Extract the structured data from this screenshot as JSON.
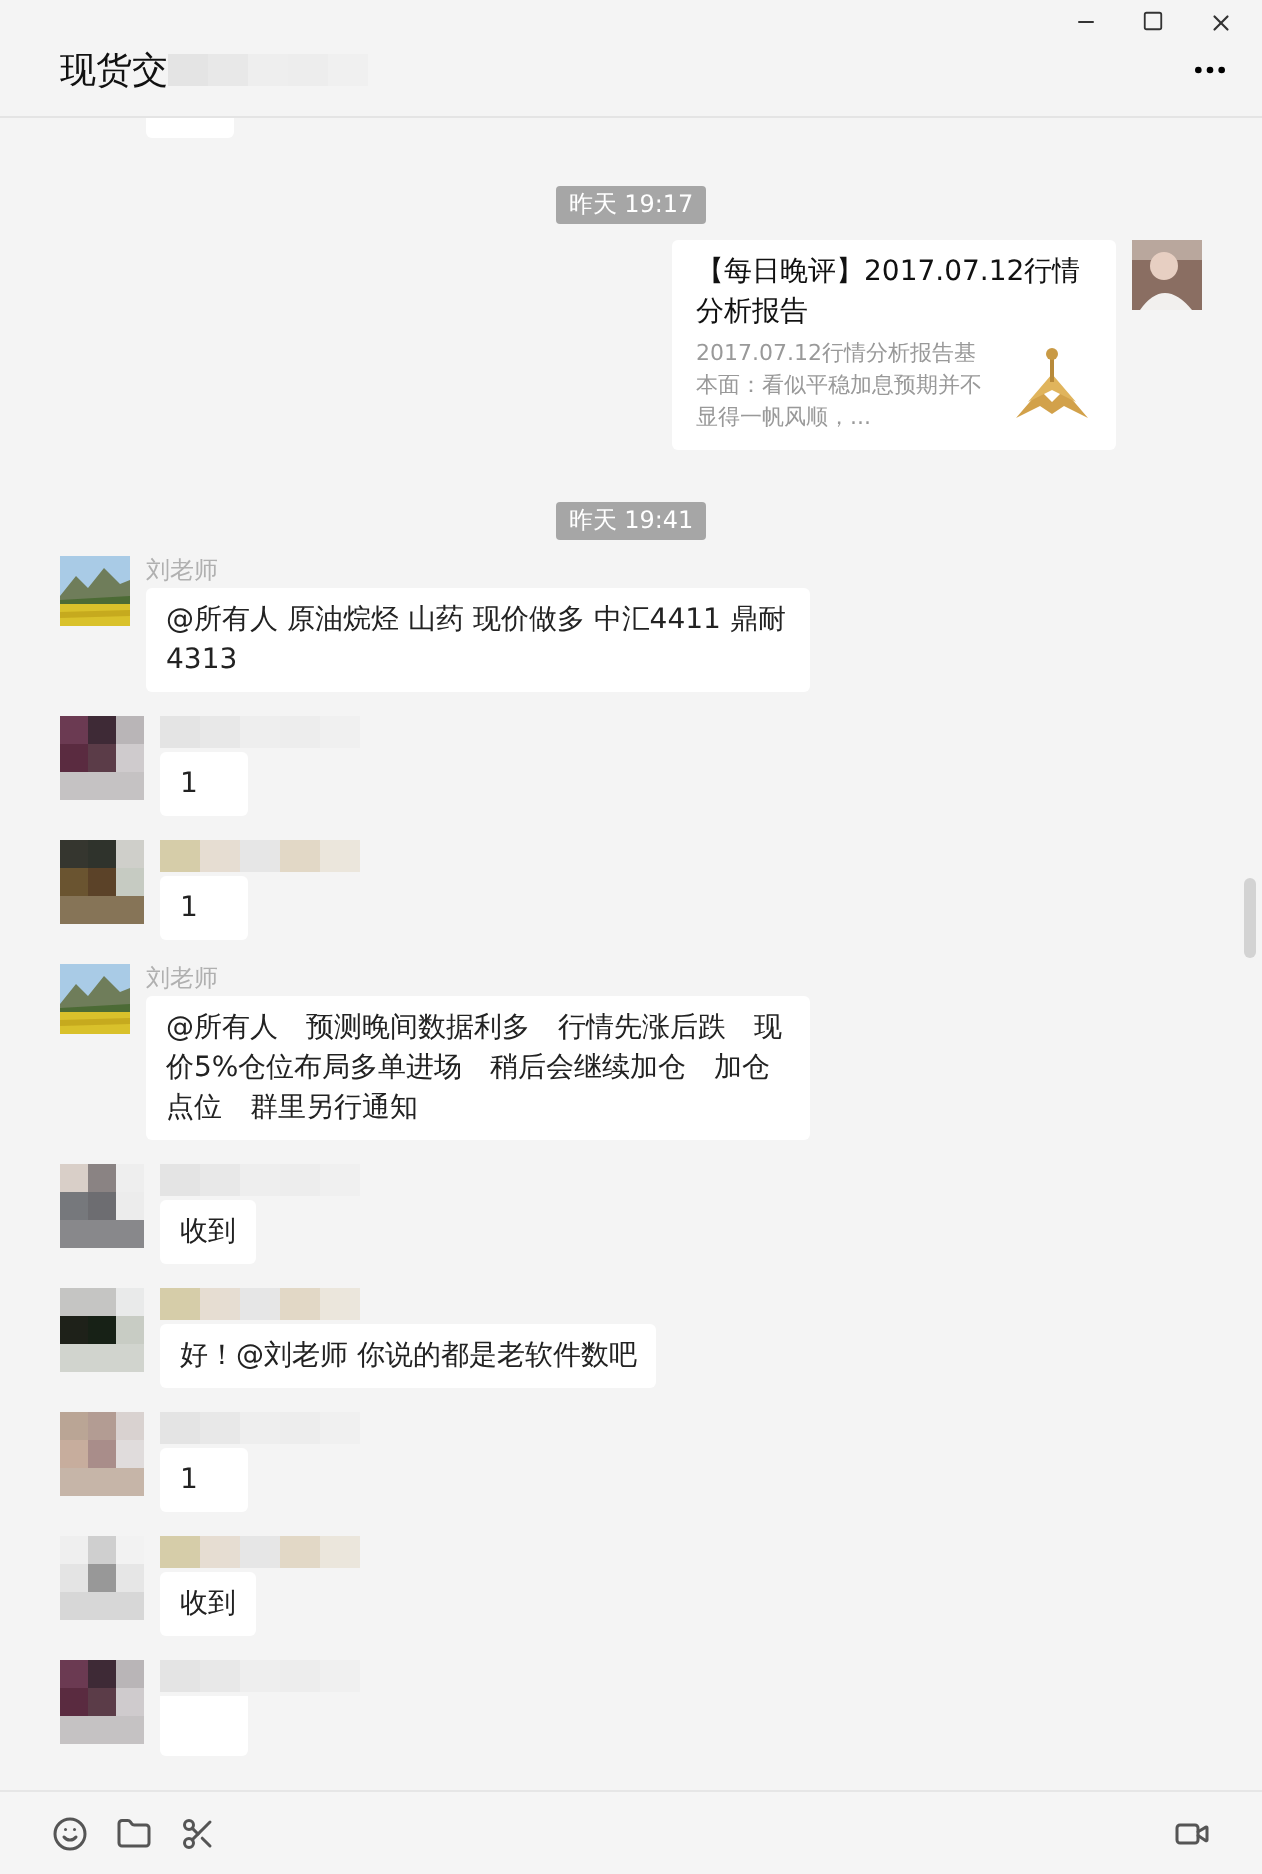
{
  "window": {
    "title": "现货交"
  },
  "messages": [
    {
      "kind": "stub"
    },
    {
      "kind": "time",
      "text": "昨天 19:17"
    },
    {
      "kind": "article",
      "title": "【每日晚评】2017.07.12行情分析报告",
      "summary": "2017.07.12行情分析报告基本面：看似平稳加息预期并不显得一帆风顺，..."
    },
    {
      "kind": "time",
      "text": "昨天 19:41"
    },
    {
      "kind": "text",
      "sender": "刘老师",
      "text": "@所有人 原油烷烃 山药 现价做多  中汇4411  鼎耐4313"
    },
    {
      "kind": "text",
      "text": "1"
    },
    {
      "kind": "text",
      "text": "1"
    },
    {
      "kind": "text",
      "sender": "刘老师",
      "text": "@所有人　预测晚间数据利多　行情先涨后跌　现价5%仓位布局多单进场　稍后会继续加仓　加仓点位　群里另行通知"
    },
    {
      "kind": "text",
      "text": "收到"
    },
    {
      "kind": "text",
      "text": "好！@刘老师 你说的都是老软件数吧"
    },
    {
      "kind": "text",
      "text": "1"
    },
    {
      "kind": "text",
      "text": "收到"
    },
    {
      "kind": "cut"
    }
  ]
}
